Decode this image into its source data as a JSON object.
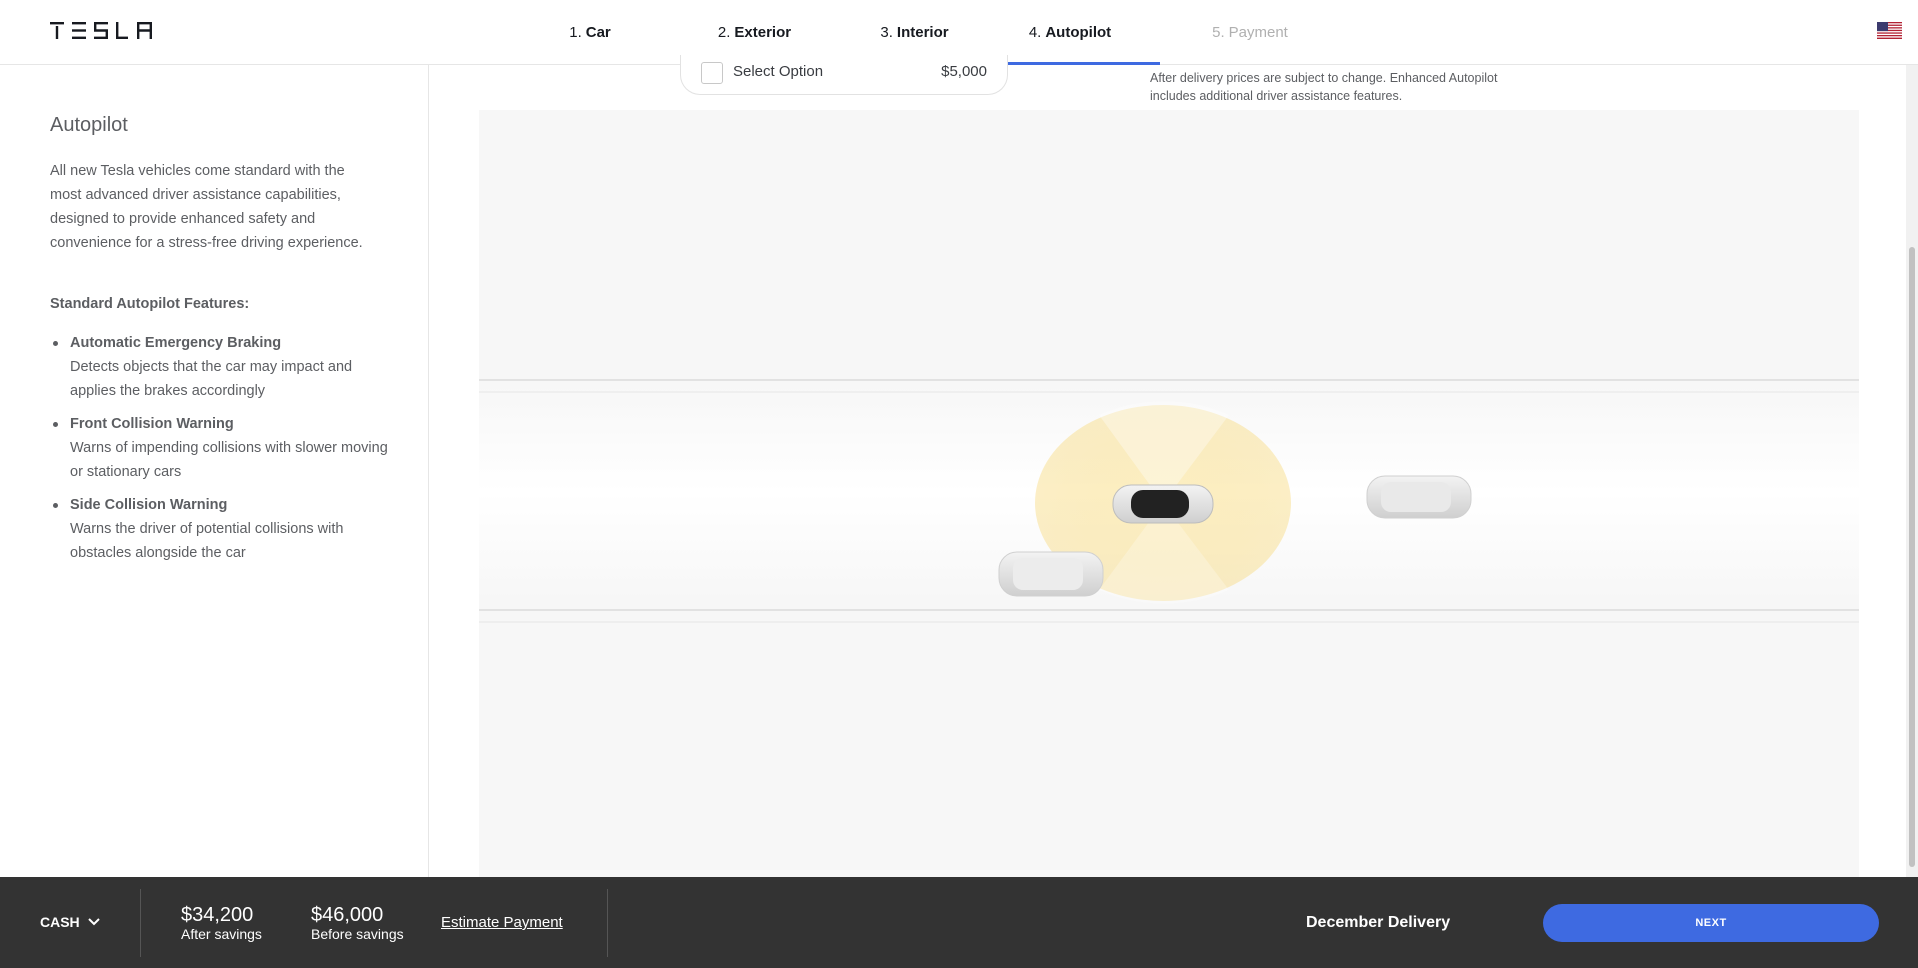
{
  "brand": {
    "logo_text": "TESLA"
  },
  "header": {
    "steps": [
      {
        "num": "1.",
        "label": "Car",
        "state": "complete"
      },
      {
        "num": "2.",
        "label": "Exterior",
        "state": "complete"
      },
      {
        "num": "3.",
        "label": "Interior",
        "state": "complete"
      },
      {
        "num": "4.",
        "label": "Autopilot",
        "state": "active"
      },
      {
        "num": "5.",
        "label": "Payment",
        "state": "disabled"
      }
    ],
    "region_icon": "us-flag-icon"
  },
  "sidebar": {
    "title": "Autopilot",
    "description": "All new Tesla vehicles come standard with the most advanced driver assistance capabilities, designed to provide enhanced safety and convenience for a stress-free driving experience.",
    "features_heading": "Standard Autopilot Features:",
    "features": [
      {
        "title": "Automatic Emergency Braking",
        "desc": "Detects objects that the car may impact and applies the brakes accordingly"
      },
      {
        "title": "Front Collision Warning",
        "desc": "Warns of impending collisions with slower moving or stationary cars"
      },
      {
        "title": "Side Collision Warning",
        "desc": "Warns the driver of potential collisions with obstacles alongside the car"
      }
    ]
  },
  "main": {
    "option": {
      "label": "Select Option",
      "price": "$5,000",
      "checked": false
    },
    "disclaimer": "After delivery prices are subject to change. Enhanced Autopilot includes additional driver assistance features.",
    "scene_description_icon": "autopilot-sensor-visualization"
  },
  "footer": {
    "payment_method": "CASH",
    "after_savings_price": "$34,200",
    "after_savings_label": "After savings",
    "before_savings_price": "$46,000",
    "before_savings_label": "Before savings",
    "estimate_link": "Estimate Payment",
    "delivery": "December Delivery",
    "next_label": "NEXT"
  },
  "colors": {
    "accent": "#3e6ae1",
    "footer_bg": "#333333",
    "text": "#393c41",
    "sensor": "#f7d774"
  }
}
